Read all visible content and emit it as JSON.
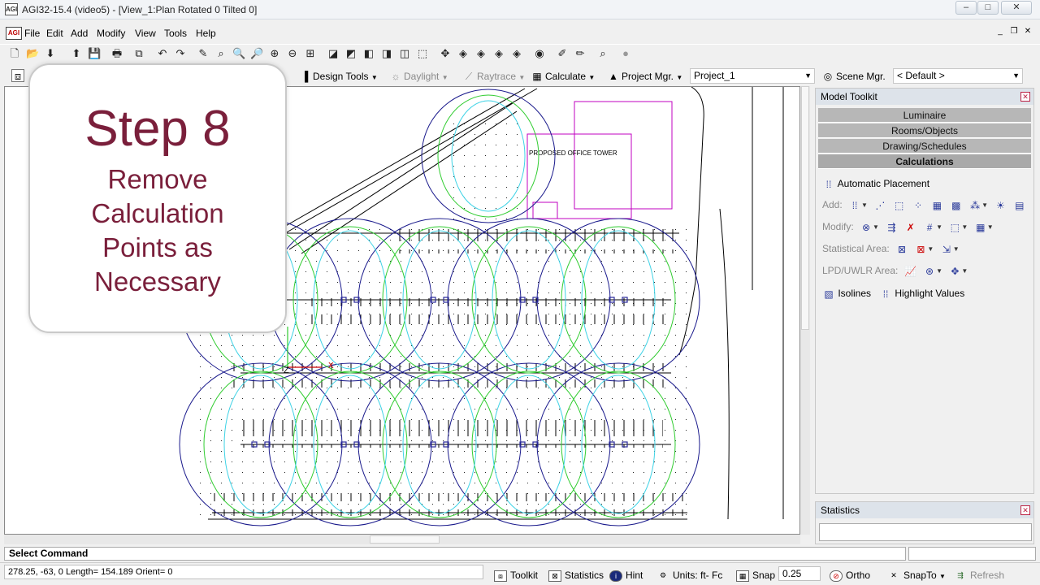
{
  "window": {
    "title": "AGI32-15.4 (video5) - [View_1:Plan Rotated 0 Tilted 0]",
    "app_icon": "AGI"
  },
  "menu": [
    "File",
    "Edit",
    "Add",
    "Modify",
    "View",
    "Tools",
    "Help"
  ],
  "toolbar2": {
    "design_tools": "Design Tools",
    "daylight": "Daylight",
    "raytrace": "Raytrace",
    "calculate": "Calculate",
    "project_mgr": "Project Mgr.",
    "project_value": "Project_1",
    "scene_mgr": "Scene Mgr.",
    "scene_value": "< Default >"
  },
  "overlay": {
    "step": "Step 8",
    "lines": [
      "Remove",
      "Calculation",
      "Points as",
      "Necessary"
    ]
  },
  "drawing": {
    "building_label": "PROPOSED OFFICE TOWER"
  },
  "model_toolkit": {
    "title": "Model Toolkit",
    "categories": [
      "Luminaire",
      "Rooms/Objects",
      "Drawing/Schedules",
      "Calculations"
    ],
    "automatic_placement": "Automatic Placement",
    "add_label": "Add:",
    "modify_label": "Modify:",
    "statistical_area_label": "Statistical Area:",
    "lpd_label": "LPD/UWLR Area:",
    "isolines": "Isolines",
    "highlight_values": "Highlight Values"
  },
  "statistics_panel": {
    "title": "Statistics"
  },
  "command": {
    "prompt": "Select Command"
  },
  "status": {
    "coords": "278.25, -63, 0 Length= 154.189 Orient= 0",
    "toolkit": "Toolkit",
    "statistics": "Statistics",
    "hint": "Hint",
    "units": "Units: ft- Fc",
    "snap": "Snap",
    "snap_value": "0.25",
    "ortho": "Ortho",
    "snapto": "SnapTo",
    "refresh": "Refresh"
  },
  "colors": {
    "overlay_text": "#7a1f3b",
    "circle_blue": "#1a1a8c",
    "circle_green": "#2fcc2f",
    "circle_cyan": "#3fd3e6",
    "building_magenta": "#c000c0"
  }
}
